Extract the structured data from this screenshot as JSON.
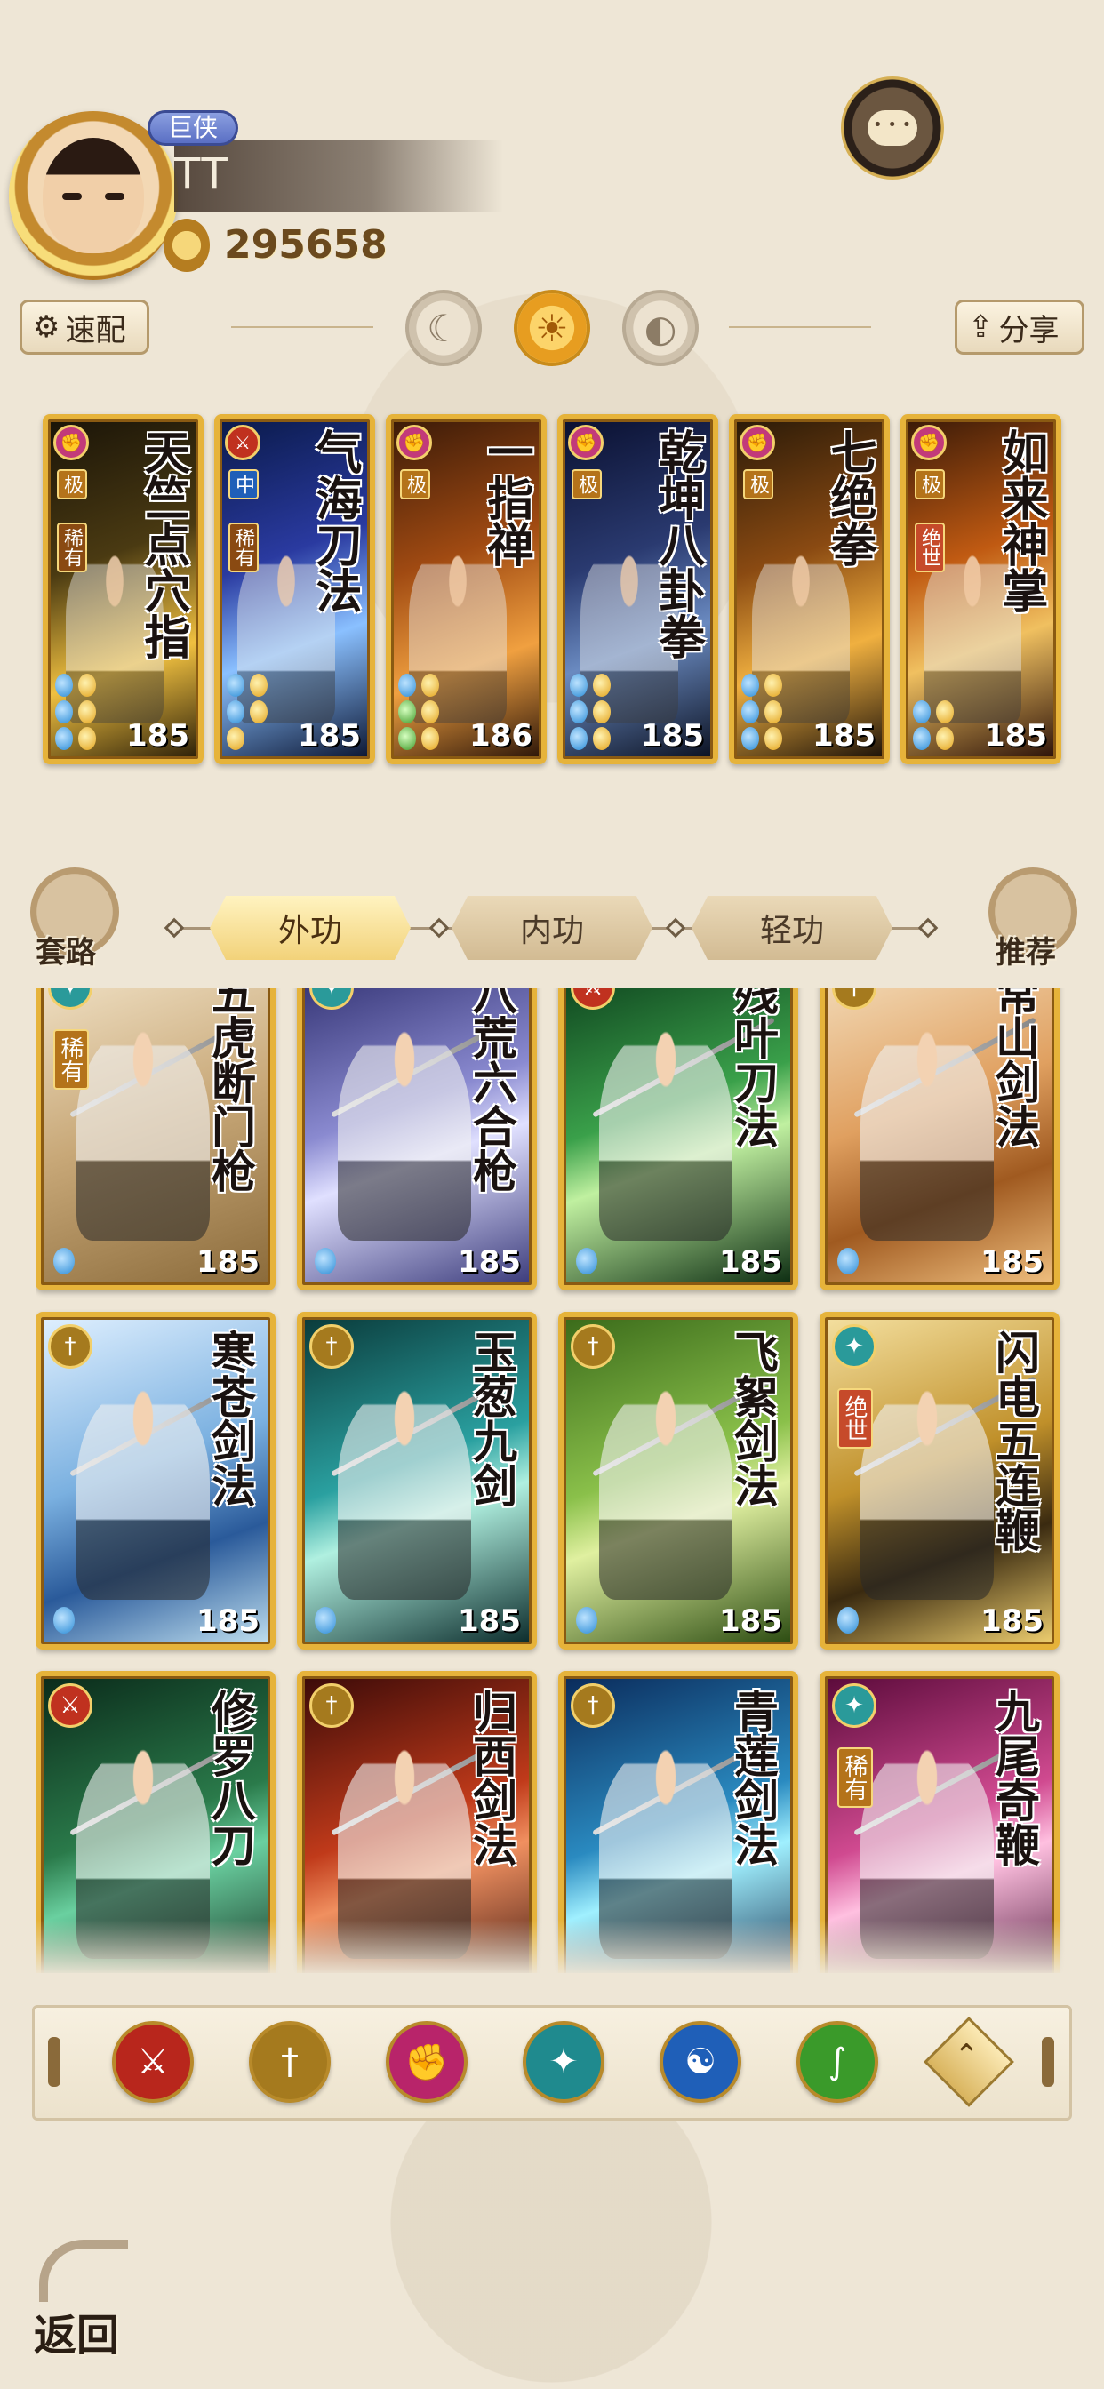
{
  "header": {
    "title_badge": "巨侠",
    "player_name": "TT",
    "power": "295658"
  },
  "toolbar": {
    "quick_config_label": "速配",
    "share_label": "分享",
    "presets": [
      "moon",
      "sun",
      "crescent"
    ],
    "active_preset_index": 1
  },
  "equipped": [
    {
      "name": "天竺点穴指",
      "tag_grade": "极",
      "tag_rarity": "稀有",
      "level": "185",
      "type_color": "#c23a7a"
    },
    {
      "name": "气海刀法",
      "tag_grade": "中",
      "tag_rarity": "稀有",
      "level": "185",
      "type_color": "#c0311f"
    },
    {
      "name": "一指禅",
      "tag_grade": "极",
      "tag_rarity": "",
      "level": "186",
      "type_color": "#c23a7a"
    },
    {
      "name": "乾坤八卦拳",
      "tag_grade": "极",
      "tag_rarity": "",
      "level": "185",
      "type_color": "#c23a7a"
    },
    {
      "name": "七绝拳",
      "tag_grade": "极",
      "tag_rarity": "",
      "level": "185",
      "type_color": "#c23a7a"
    },
    {
      "name": "如来神掌",
      "tag_grade": "极",
      "tag_rarity": "绝世",
      "level": "185",
      "type_color": "#c23a7a"
    }
  ],
  "tabs": {
    "left_label": "套路",
    "right_label": "推荐",
    "items": [
      "外功",
      "内功",
      "轻功"
    ],
    "active_index": 0
  },
  "skills": [
    {
      "name": "五虎断门枪",
      "tag": "稀有",
      "level": "185",
      "type_color": "#2a9a9a"
    },
    {
      "name": "八荒六合枪",
      "tag": "",
      "level": "185",
      "type_color": "#2a9a9a"
    },
    {
      "name": "残叶刀法",
      "tag": "",
      "level": "185",
      "type_color": "#c0311f"
    },
    {
      "name": "常山剑法",
      "tag": "",
      "level": "185",
      "type_color": "#a57a1e"
    },
    {
      "name": "寒苍剑法",
      "tag": "",
      "level": "185",
      "type_color": "#a57a1e"
    },
    {
      "name": "玉葱九剑",
      "tag": "",
      "level": "185",
      "type_color": "#a57a1e"
    },
    {
      "name": "飞絮剑法",
      "tag": "",
      "level": "185",
      "type_color": "#a57a1e"
    },
    {
      "name": "闪电五连鞭",
      "tag": "绝世",
      "level": "185",
      "type_color": "#2a9a9a"
    },
    {
      "name": "修罗八刀",
      "tag": "",
      "level": "",
      "type_color": "#c0311f"
    },
    {
      "name": "归西剑法",
      "tag": "",
      "level": "",
      "type_color": "#a57a1e"
    },
    {
      "name": "青莲剑法",
      "tag": "",
      "level": "",
      "type_color": "#a57a1e"
    },
    {
      "name": "九尾奇鞭",
      "tag": "稀有",
      "level": "",
      "type_color": "#2a9a9a"
    }
  ],
  "filters": [
    {
      "icon": "blade-icon",
      "color": "#b8261c"
    },
    {
      "icon": "sword-icon",
      "color": "#a57a1e"
    },
    {
      "icon": "fist-icon",
      "color": "#b8246a"
    },
    {
      "icon": "fan-icon",
      "color": "#1f8a8e"
    },
    {
      "icon": "yinyang-icon",
      "color": "#1f5fb8"
    },
    {
      "icon": "hook-icon",
      "color": "#3a9a2a"
    }
  ],
  "back_label": "返回"
}
